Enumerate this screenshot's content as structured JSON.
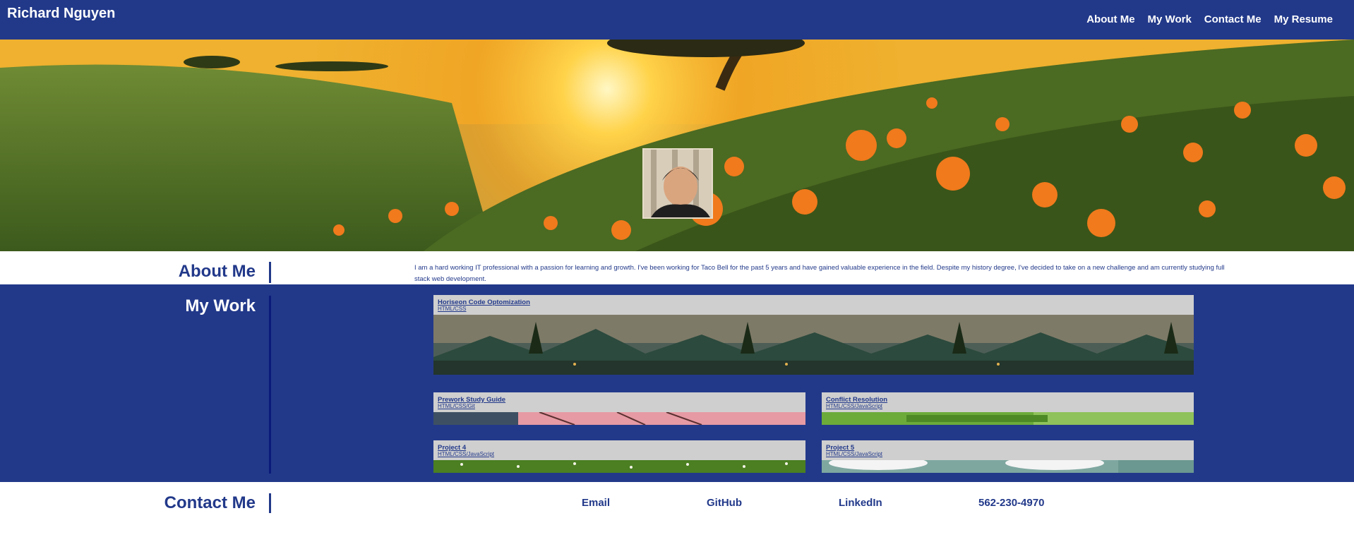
{
  "header": {
    "brand": "Richard Nguyen",
    "nav": [
      "About Me",
      "My Work",
      "Contact Me",
      "My Resume"
    ]
  },
  "about": {
    "title": "About Me",
    "text": "I am a hard working IT professional with a passion for learning and growth. I've been working for Taco Bell for the past 5 years and have gained valuable experience in the field. Despite my history degree, I've decided to take on a new challenge and am currently studying full stack web development."
  },
  "work": {
    "title": "My Work",
    "projects": [
      {
        "title": "Horiseon Code Optomization",
        "stack": "HTML/CSS"
      },
      {
        "title": "Prework Study Guide",
        "stack": "HTML/CSS/Git"
      },
      {
        "title": "Conflict Resolution",
        "stack": "HTML/CSS/JavaScript"
      },
      {
        "title": "Project 4",
        "stack": "HTML/CSS/JavaScript"
      },
      {
        "title": "Project 5",
        "stack": "HTML/CSS/JavaScript"
      }
    ]
  },
  "contact": {
    "title": "Contact Me",
    "links": [
      "Email",
      "GitHub",
      "LinkedIn",
      "562-230-4970"
    ]
  },
  "colors": {
    "primary": "#22398a",
    "card": "#cfcfcf",
    "white": "#ffffff"
  }
}
